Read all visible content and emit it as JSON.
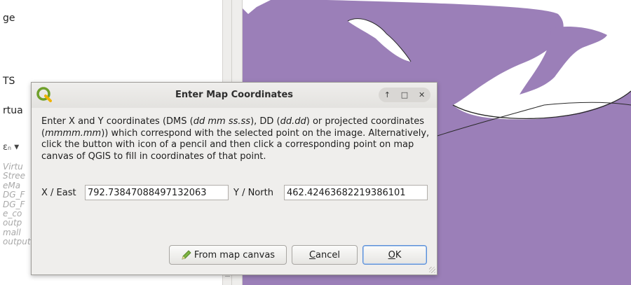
{
  "left_panel": {
    "fragments": [
      "ge",
      "TS",
      "rtua"
    ],
    "tool_glyph": "ε",
    "list_items": [
      "Virtu",
      "Stree",
      "eMa",
      "DG_F",
      "DG_F",
      "e_co",
      "outp",
      "mall",
      "output"
    ]
  },
  "dialog": {
    "title": "Enter Map Coordinates",
    "window_controls": [
      "↑",
      "□",
      "✕"
    ],
    "description": {
      "p1": "Enter X and Y coordinates (DMS (",
      "dms": "dd mm ss.ss",
      "p2": "), DD (",
      "dd": "dd.dd",
      "p3": ") or projected coordinates (",
      "proj": "mmmm.mm",
      "p4": ")) which correspond with the selected point on the image. Alternatively, click the button with icon of a pencil and then click a corresponding point on map canvas of QGIS to fill in coordinates of that point."
    },
    "x_label": "X / East",
    "x_value": "792.73847088497132063",
    "y_label": "Y / North",
    "y_value": "462.42463682219386101",
    "buttons": {
      "from_map": "From map canvas",
      "cancel_mnemonic": "C",
      "cancel_rest": "ancel",
      "ok_mnemonic": "O",
      "ok_rest": "K"
    }
  },
  "colors": {
    "map_land": "#9b7fb8",
    "dialog_bg": "#efeeec",
    "accent": "#5a8ed6"
  }
}
